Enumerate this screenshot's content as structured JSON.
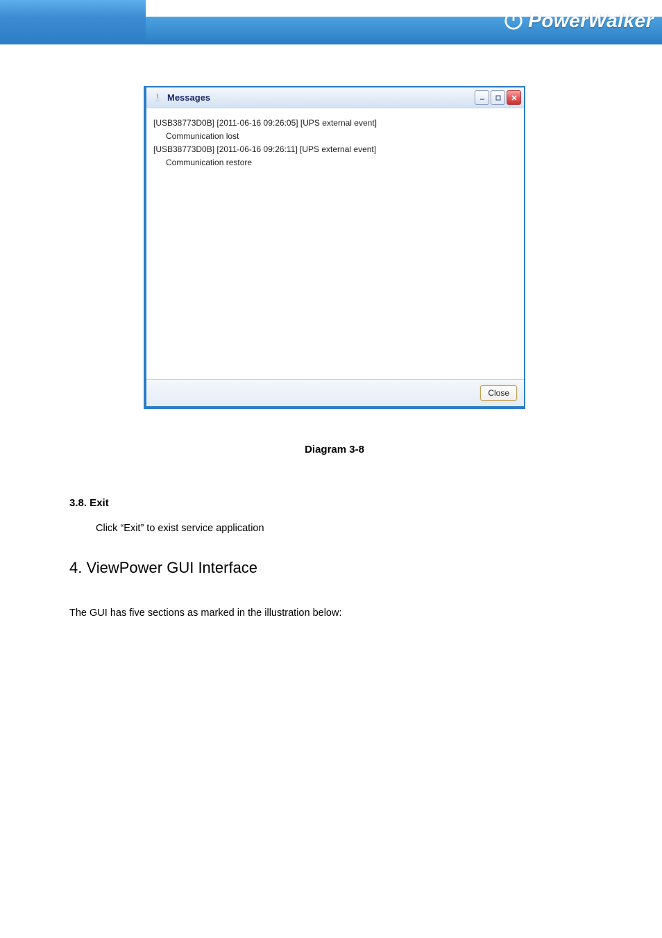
{
  "brand": {
    "name": "PowerWalker"
  },
  "dialog": {
    "title": "Messages",
    "messages": [
      {
        "header": "[USB38773D0B] [2011-06-16 09:26:05] [UPS external event]",
        "detail": "Communication lost"
      },
      {
        "header": "[USB38773D0B] [2011-06-16 09:26:11] [UPS external event]",
        "detail": "Communication restore"
      }
    ],
    "close_label": "Close"
  },
  "caption": "Diagram 3-8",
  "section_3_8": {
    "heading": "3.8. Exit",
    "body": "Click “Exit” to exist service application"
  },
  "chapter_4": {
    "heading": "4. ViewPower GUI Interface",
    "intro": "The GUI has five sections as marked in the illustration below:"
  }
}
